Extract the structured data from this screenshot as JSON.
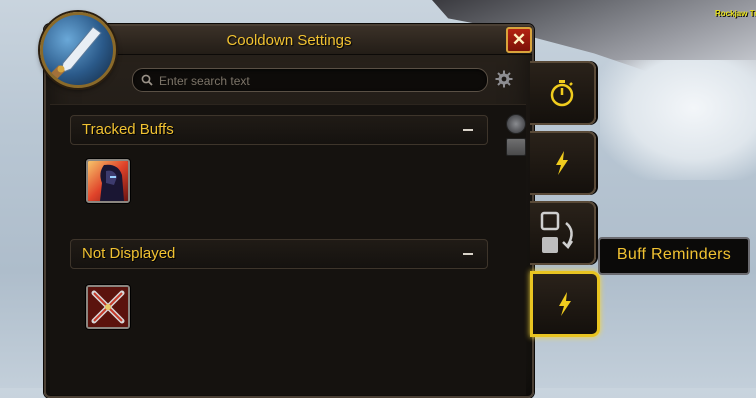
{
  "world": {
    "nameplate": "Rockjaw Tro"
  },
  "window": {
    "title": "Cooldown Settings",
    "close_label": "✕",
    "portrait_icon": "sword-spell-icon"
  },
  "search": {
    "placeholder": "Enter search text",
    "value": ""
  },
  "sections": [
    {
      "label": "Tracked Buffs",
      "collapse_symbol": "minus",
      "icons": [
        "hooded-figure-buff-icon"
      ]
    },
    {
      "label": "Not Displayed",
      "collapse_symbol": "minus",
      "icons": [
        "crossed-swords-icon"
      ]
    }
  ],
  "side_tabs": [
    {
      "icon": "stopwatch-icon",
      "active": false
    },
    {
      "icon": "lightning-icon",
      "active": false
    },
    {
      "icon": "swap-layout-icon",
      "active": false
    },
    {
      "icon": "lightning-icon",
      "active": true
    }
  ],
  "tooltip": {
    "text": "Buff Reminders"
  },
  "colors": {
    "gold_text": "#f1c232",
    "active_border": "#e8c421",
    "close_red": "#b32212"
  }
}
